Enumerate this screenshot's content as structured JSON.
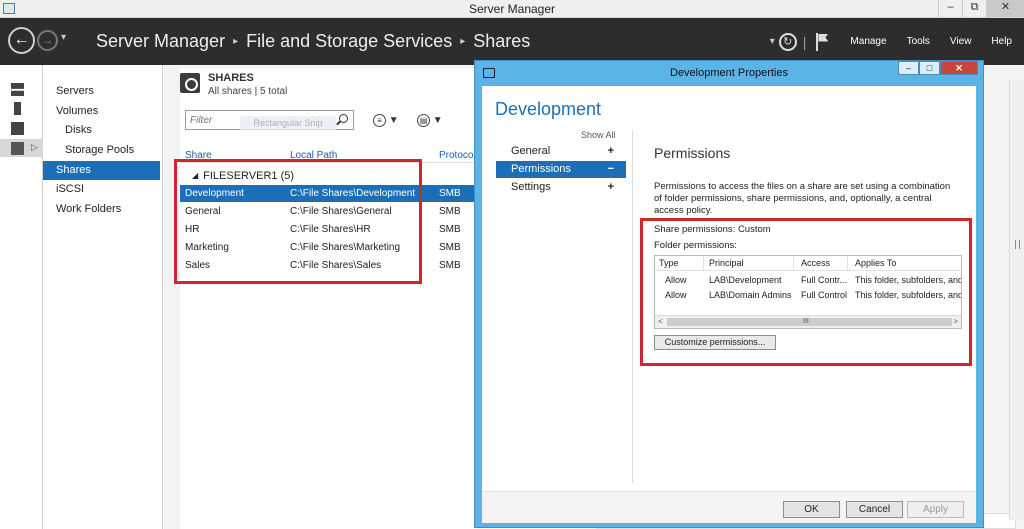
{
  "window": {
    "title": "Server Manager",
    "min_glyph": "–",
    "restore_glyph": "⧉",
    "close_glyph": "✕"
  },
  "header": {
    "back_glyph": "←",
    "forward_glyph": "→",
    "breadcrumb": [
      "Server Manager",
      "File and Storage Services",
      "Shares"
    ],
    "separator_glyph": "▸",
    "dropdown_glyph": "▾",
    "refresh_glyph": "↻",
    "divider": "|",
    "menus": [
      "Manage",
      "Tools",
      "View",
      "Help"
    ]
  },
  "nav": {
    "items": [
      {
        "label": "Servers",
        "indent": false,
        "selected": false
      },
      {
        "label": "Volumes",
        "indent": false,
        "selected": false
      },
      {
        "label": "Disks",
        "indent": true,
        "selected": false
      },
      {
        "label": "Storage Pools",
        "indent": true,
        "selected": false
      },
      {
        "label": "Shares",
        "indent": false,
        "selected": true
      },
      {
        "label": "iSCSI",
        "indent": false,
        "selected": false
      },
      {
        "label": "Work Folders",
        "indent": false,
        "selected": false
      }
    ],
    "rail_arrow_glyph": "▷"
  },
  "shares": {
    "title": "SHARES",
    "subtitle": "All shares | 5 total",
    "filter_placeholder": "Filter",
    "snip_overlay": "Rectangular Snip",
    "tool1_glyph": "≡",
    "tool2_glyph": "▤",
    "tool_dropdown_glyph": "▼",
    "columns": [
      "Share",
      "Local Path",
      "Protocol"
    ],
    "group_label": "FILESERVER1 (5)",
    "group_glyph": "◢",
    "rows": [
      {
        "share": "Development",
        "path": "C:\\File Shares\\Development",
        "protocol": "SMB",
        "selected": true
      },
      {
        "share": "General",
        "path": "C:\\File Shares\\General",
        "protocol": "SMB",
        "selected": false
      },
      {
        "share": "HR",
        "path": "C:\\File Shares\\HR",
        "protocol": "SMB",
        "selected": false
      },
      {
        "share": "Marketing",
        "path": "C:\\File Shares\\Marketing",
        "protocol": "SMB",
        "selected": false
      },
      {
        "share": "Sales",
        "path": "C:\\File Shares\\Sales",
        "protocol": "SMB",
        "selected": false
      }
    ]
  },
  "dialog": {
    "title": "Development Properties",
    "min_glyph": "–",
    "max_glyph": "□",
    "close_glyph": "✕",
    "heading": "Development",
    "show_all": "Show All",
    "nav": [
      {
        "label": "General",
        "sign": "+",
        "selected": false
      },
      {
        "label": "Permissions",
        "sign": "−",
        "selected": true
      },
      {
        "label": "Settings",
        "sign": "+",
        "selected": false
      }
    ],
    "section_title": "Permissions",
    "description": "Permissions to access the files on a share are set using a combination of folder permissions, share permissions, and, optionally, a central access policy.",
    "share_permissions": "Share permissions: Custom",
    "folder_permissions_label": "Folder permissions:",
    "table": {
      "columns": [
        "Type",
        "Principal",
        "Access",
        "Applies To"
      ],
      "rows": [
        {
          "type": "Allow",
          "principal": "LAB\\Development",
          "access": "Full Contr...",
          "applies": "This folder, subfolders, and"
        },
        {
          "type": "Allow",
          "principal": "LAB\\Domain Admins",
          "access": "Full Control",
          "applies": "This folder, subfolders, and"
        }
      ],
      "scroll_left_glyph": "<",
      "scroll_right_glyph": ">",
      "scroll_grip": "III"
    },
    "customize_button": "Customize permissions...",
    "buttons": {
      "ok": "OK",
      "cancel": "Cancel",
      "apply": "Apply"
    }
  },
  "colors": {
    "accent": "#1c6fb6",
    "header_bg": "#2d2d2d",
    "dialog_frame": "#5ab4e6",
    "highlight_box": "#d0272c"
  }
}
